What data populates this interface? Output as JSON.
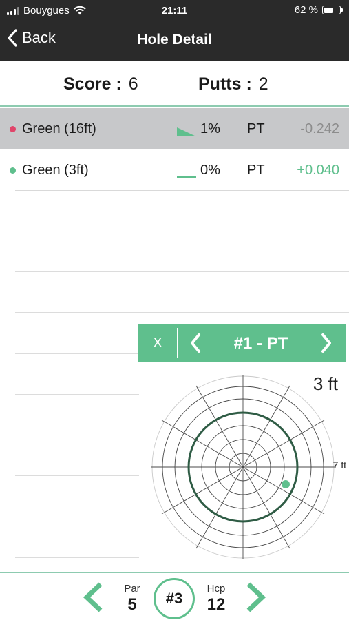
{
  "status_bar": {
    "carrier": "Bouygues",
    "time": "21:11",
    "battery": "62 %"
  },
  "nav": {
    "back_label": "Back",
    "title": "Hole Detail"
  },
  "summary": {
    "score_label": "Score :",
    "score_value": "6",
    "putts_label": "Putts :",
    "putts_value": "2"
  },
  "shots": [
    {
      "label": "Green (16ft)",
      "slope": "1%",
      "club": "PT",
      "strokes_gained": "-0.242",
      "dot_color": "#e0456a",
      "sg_color": "#8c8c8c",
      "selected": true
    },
    {
      "label": "Green (3ft)",
      "slope": "0%",
      "club": "PT",
      "strokes_gained": "+0.040",
      "dot_color": "#5fbf8d",
      "sg_color": "#5fbf8d",
      "selected": false
    }
  ],
  "shot_nav": {
    "close_label": "X",
    "shot_label": "#1 - PT"
  },
  "target": {
    "distance": "3 ft",
    "ring_label": "7 ft"
  },
  "bottom": {
    "par_label": "Par",
    "par_value": "5",
    "hole": "#3",
    "hcp_label": "Hcp",
    "hcp_value": "12"
  },
  "colors": {
    "accent": "#5fbf8d",
    "dark": "#2a2a2a",
    "selected_row": "#c7c8ca",
    "miss": "#e0456a"
  }
}
